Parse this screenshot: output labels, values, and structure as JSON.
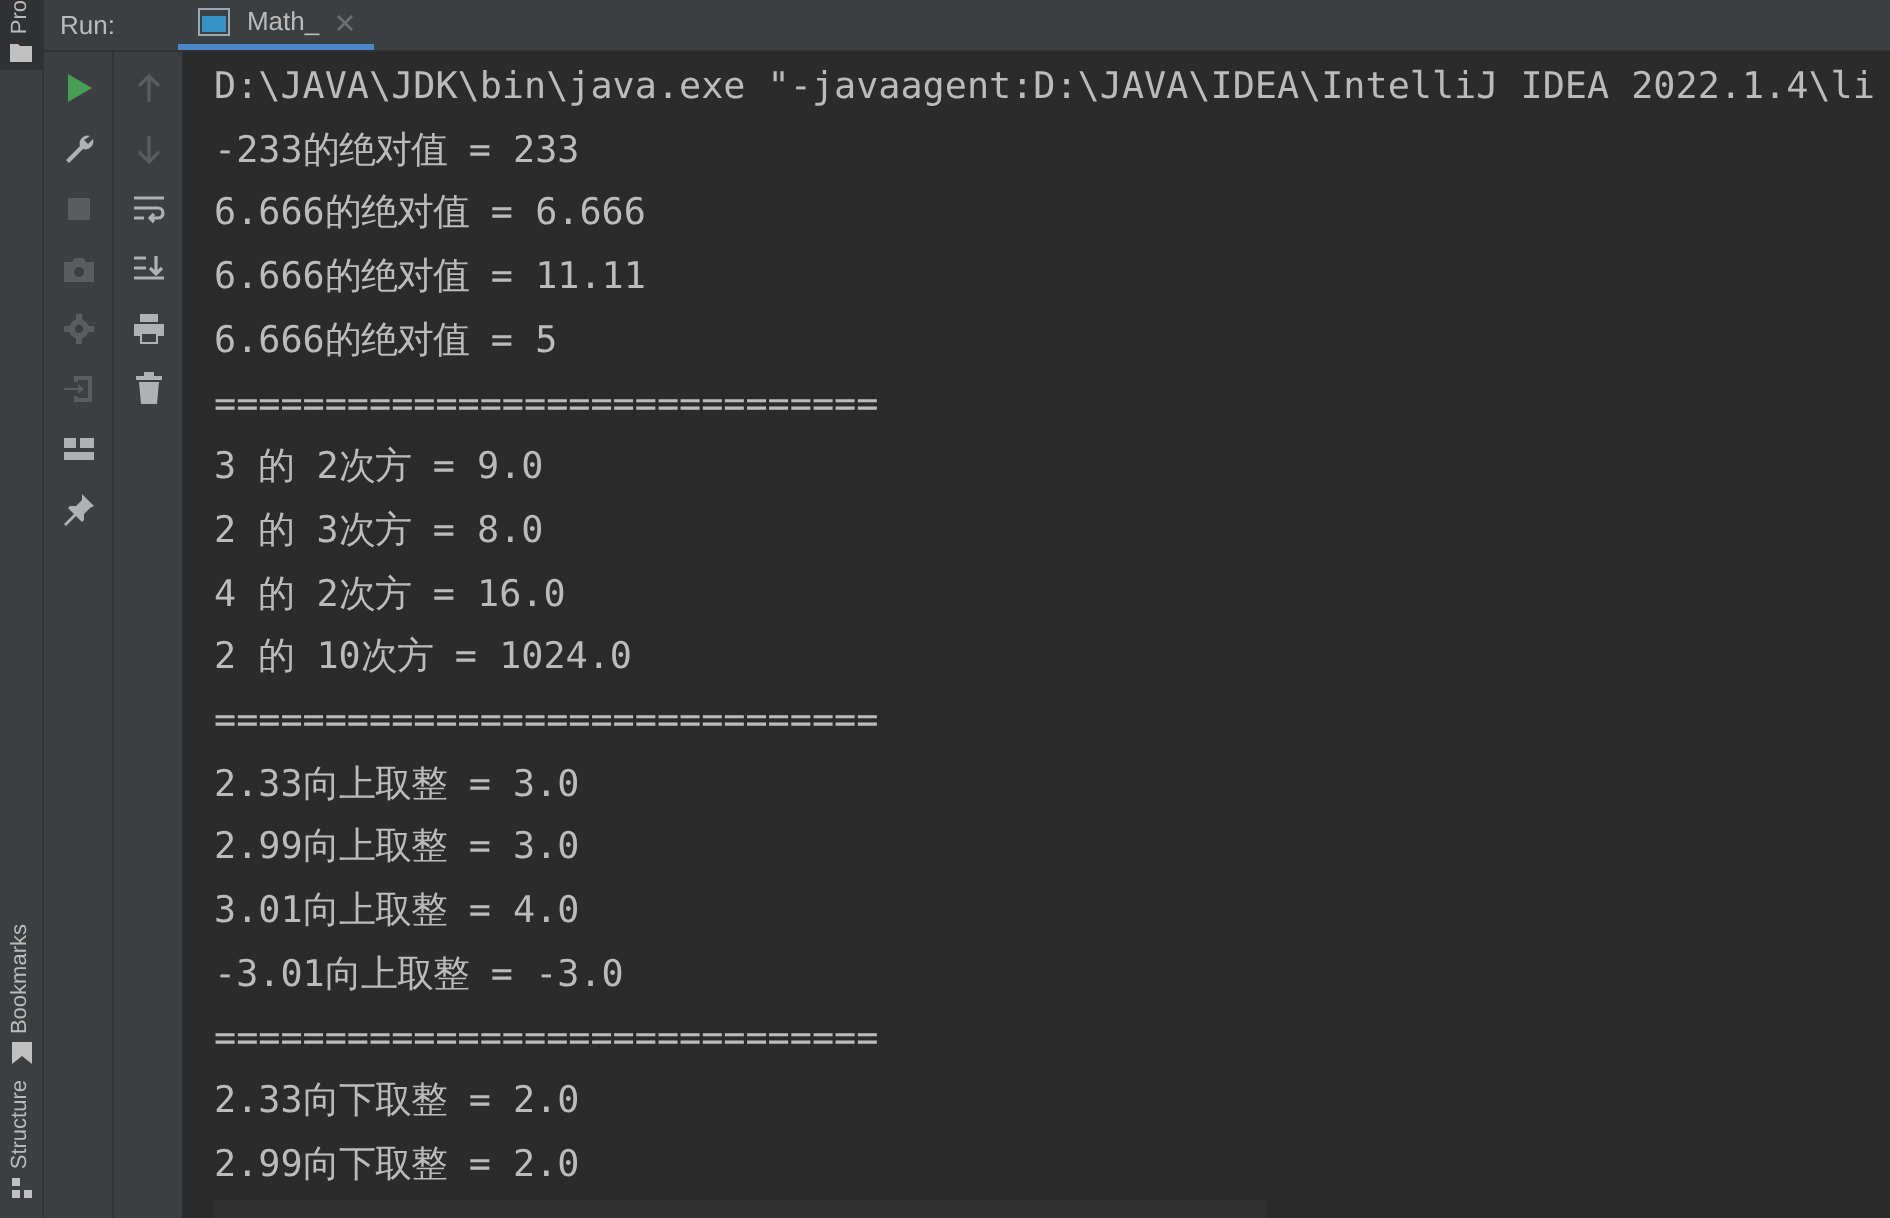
{
  "side_tabs": [
    {
      "label": "Pro",
      "kind": "project"
    },
    {
      "label": "Bookmarks",
      "kind": "bookmarks"
    },
    {
      "label": "Structure",
      "kind": "structure"
    }
  ],
  "run_bar": {
    "title": "Run:",
    "tabs": [
      {
        "label": "Math_",
        "selected": true
      }
    ]
  },
  "toolbar_1": [
    {
      "kind": "run",
      "disabled": false
    },
    {
      "kind": "wrench",
      "disabled": false
    },
    {
      "kind": "stop",
      "disabled": true
    },
    {
      "kind": "camera",
      "disabled": true
    },
    {
      "kind": "gear",
      "disabled": true
    },
    {
      "kind": "exit",
      "disabled": true
    },
    {
      "kind": "layout",
      "disabled": false
    },
    {
      "kind": "pin",
      "disabled": false
    }
  ],
  "toolbar_2": [
    {
      "kind": "up",
      "disabled": true
    },
    {
      "kind": "down",
      "disabled": true
    },
    {
      "kind": "wrap",
      "disabled": false
    },
    {
      "kind": "scroll-end",
      "disabled": false
    },
    {
      "kind": "print",
      "disabled": false
    },
    {
      "kind": "trash",
      "disabled": false
    }
  ],
  "console": {
    "lines": [
      "D:\\JAVA\\JDK\\bin\\java.exe \"-javaagent:D:\\JAVA\\IDEA\\IntelliJ IDEA 2022.1.4\\li",
      "-233的绝对值 = 233",
      "6.666的绝对值 = 6.666",
      "6.666的绝对值 = 11.11",
      "6.666的绝对值 = 5",
      "==============================",
      "3 的 2次方 = 9.0",
      "2 的 3次方 = 8.0",
      "4 的 2次方 = 16.0",
      "2 的 10次方 = 1024.0",
      "==============================",
      "2.33向上取整 = 3.0",
      "2.99向上取整 = 3.0",
      "3.01向上取整 = 4.0",
      "-3.01向上取整 = -3.0",
      "==============================",
      "2.33向下取整 = 2.0",
      "2.99向下取整 = 2.0"
    ]
  }
}
